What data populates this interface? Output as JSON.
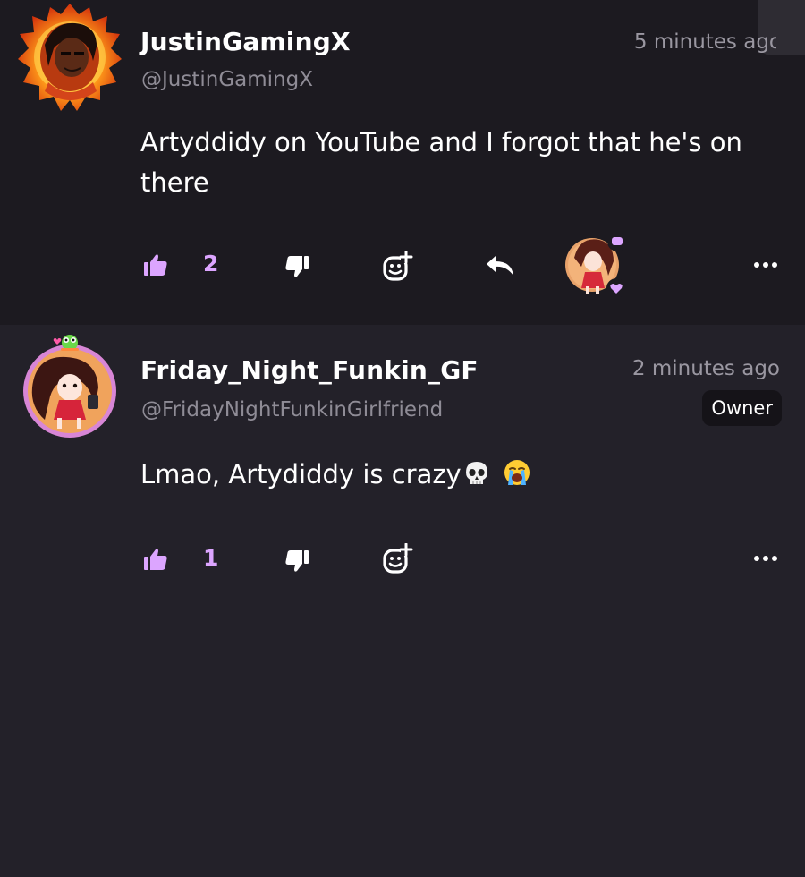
{
  "comments": [
    {
      "author": "JustinGamingX",
      "handle": "@JustinGamingX",
      "time": "5 minutes ago",
      "text": "Artyddidy on YouTube and I forgot that he's on there",
      "likes": "2"
    },
    {
      "author": "Friday_Night_Funkin_GF",
      "handle": "@FridayNightFunkinGirlfriend",
      "time": "2 minutes ago",
      "badge": "Owner",
      "text": "Lmao, Artydiddy is crazy",
      "text_emojis": [
        "skull",
        "loudly-crying-face"
      ],
      "likes": "1"
    }
  ],
  "colors": {
    "accent_like": "#dca5ff",
    "background": "#232129",
    "first_comment_bg": "#1c1a20",
    "muted_text": "#8f8c96"
  },
  "icons": [
    "thumbs-up-icon",
    "thumbs-down-icon",
    "add-reaction-icon",
    "reply-icon",
    "more-options-icon",
    "reaction-avatar-icon"
  ]
}
